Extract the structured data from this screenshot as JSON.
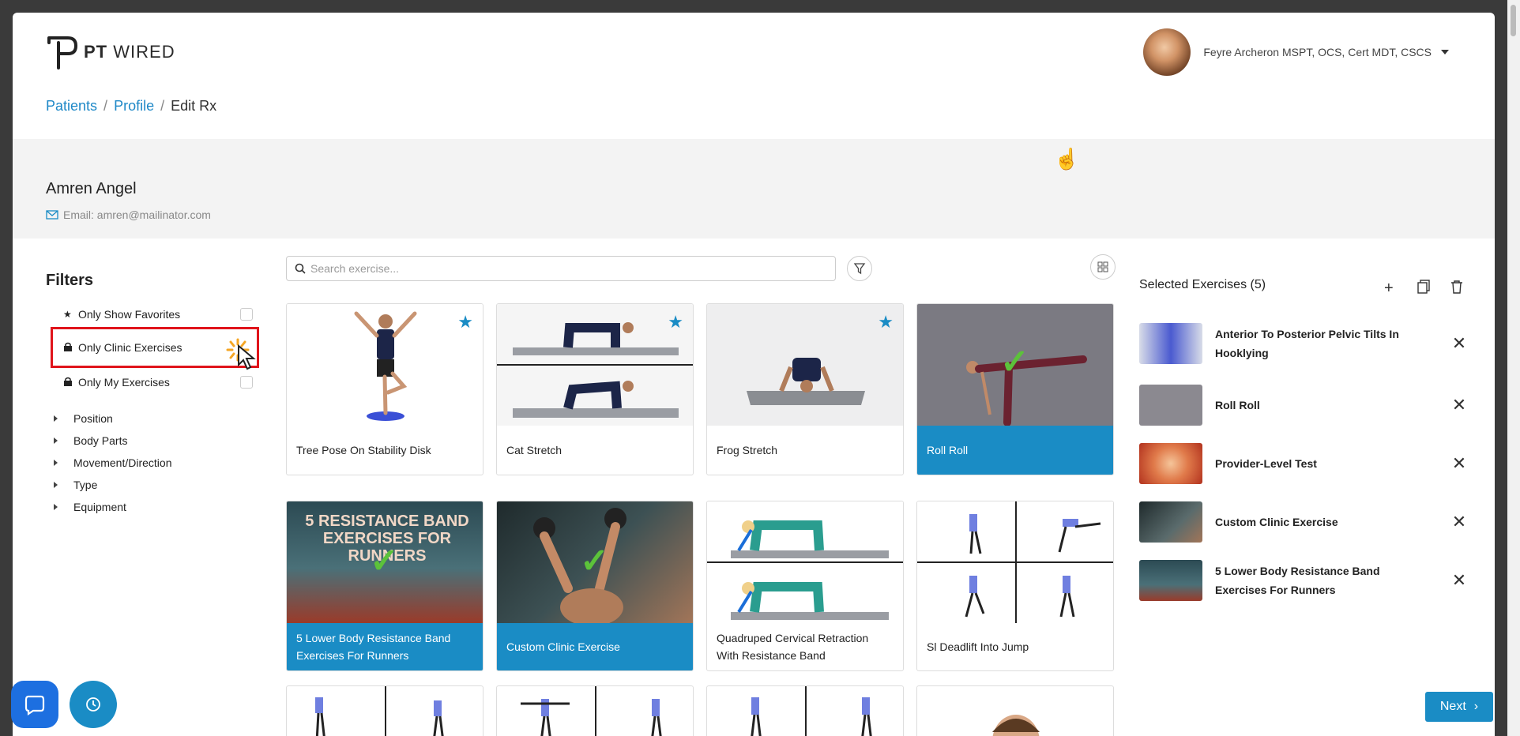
{
  "header": {
    "logo_bold": "PT",
    "logo_text": "WIRED",
    "user_name": "Feyre Archeron MSPT, OCS, Cert MDT, CSCS"
  },
  "breadcrumb": {
    "items": [
      "Patients",
      "Profile",
      "Edit Rx"
    ],
    "separator": "/"
  },
  "patient": {
    "name": "Amren Angel",
    "email": "Email: amren@mailinator.com"
  },
  "filters": {
    "title": "Filters",
    "toggles": [
      {
        "label": "Only Show Favorites",
        "icon": "star-icon"
      },
      {
        "label": "Only Clinic Exercises",
        "icon": "lock-icon"
      },
      {
        "label": "Only My Exercises",
        "icon": "lock-icon"
      }
    ],
    "categories": [
      "Position",
      "Body Parts",
      "Movement/Direction",
      "Type",
      "Equipment"
    ]
  },
  "search": {
    "placeholder": "Search exercise..."
  },
  "exercises": [
    {
      "title": "Tree Pose On Stability Disk",
      "favorite": true,
      "selected": false
    },
    {
      "title": "Cat Stretch",
      "favorite": true,
      "selected": false
    },
    {
      "title": "Frog Stretch",
      "favorite": true,
      "selected": false
    },
    {
      "title": "Roll Roll",
      "favorite": false,
      "selected": true
    },
    {
      "title": "5 Lower Body Resistance Band Exercises For Runners",
      "favorite": false,
      "selected": true,
      "thumb_text": "5 RESISTANCE BAND EXERCISES FOR RUNNERS"
    },
    {
      "title": "Custom Clinic Exercise",
      "favorite": false,
      "selected": true
    },
    {
      "title": "Quadruped Cervical Retraction With Resistance Band",
      "favorite": false,
      "selected": false
    },
    {
      "title": "Sl Deadlift Into Jump",
      "favorite": false,
      "selected": false
    }
  ],
  "selected_panel": {
    "title": "Selected Exercises (5)",
    "items": [
      "Anterior To Posterior Pelvic Tilts In Hooklying",
      "Roll Roll",
      "Provider-Level Test",
      "Custom Clinic Exercise",
      "5 Lower Body Resistance Band Exercises For Runners"
    ]
  },
  "next_label": "Next",
  "colors": {
    "accent": "#1a8cc5",
    "highlight": "#e0141b",
    "check": "#5cc23a"
  }
}
